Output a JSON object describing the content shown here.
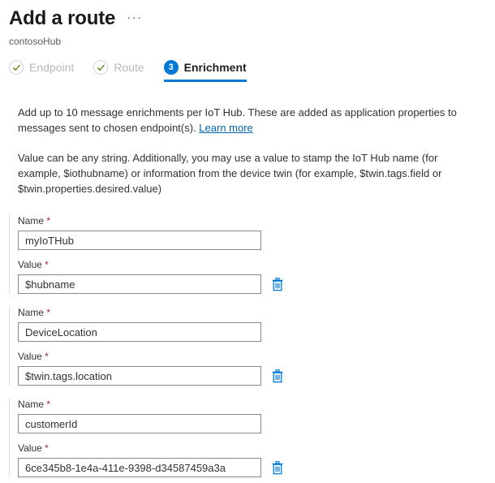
{
  "header": {
    "title": "Add a route",
    "more_label": "···",
    "subtitle": "contosoHub"
  },
  "tabs": [
    {
      "label": "Endpoint",
      "state": "completed",
      "icon": "check-circle-icon"
    },
    {
      "label": "Route",
      "state": "completed",
      "icon": "check-circle-icon"
    },
    {
      "label": "Enrichment",
      "state": "active",
      "badge": "3"
    }
  ],
  "description": {
    "paragraph1_before_link": "Add up to 10 message enrichments per IoT Hub. These are added as application properties to messages sent to chosen endpoint(s). ",
    "link_label": "Learn more",
    "paragraph2": "Value can be any string. Additionally, you may use a value to stamp the IoT Hub name (for example, $iothubname) or information from the device twin (for example, $twin.tags.field or $twin.properties.desired.value)"
  },
  "form": {
    "name_label": "Name",
    "value_label": "Value",
    "required_marker": "*",
    "delete_icon": "trash-icon",
    "enrichments": [
      {
        "name": "myIoTHub",
        "value": "$hubname"
      },
      {
        "name": "DeviceLocation",
        "value": "$twin.tags.location"
      },
      {
        "name": "customerId",
        "value": "6ce345b8-1e4a-411e-9398-d34587459a3a"
      }
    ]
  },
  "colors": {
    "accent": "#0078d4",
    "link": "#0063b1",
    "required": "#a4262c",
    "check_green": "#498205",
    "disabled_tab": "#b9b8b6"
  }
}
